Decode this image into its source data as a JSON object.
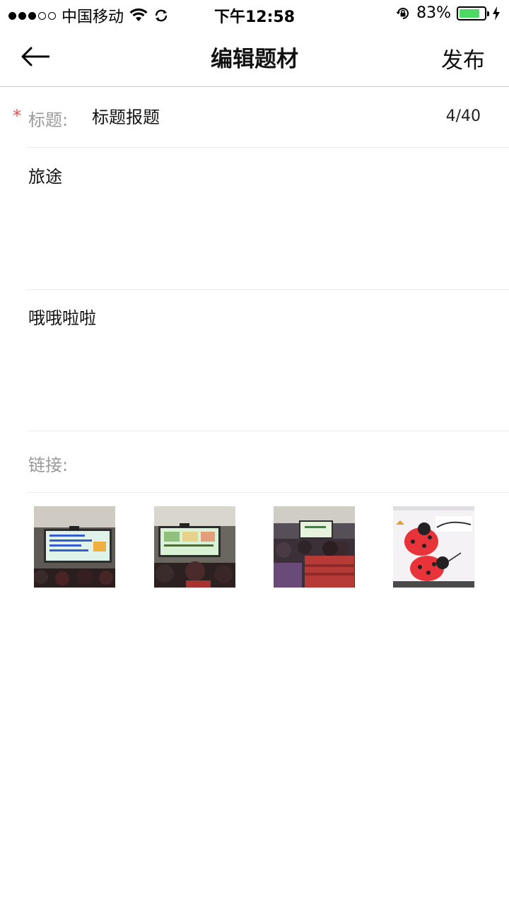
{
  "status_bar": {
    "carrier": "中国移动",
    "time": "下午12:58",
    "battery_percent_text": "83%",
    "battery_level": 0.83,
    "signal_bars_filled": 3,
    "signal_bars_total": 5,
    "battery_color": "#4cd964"
  },
  "nav": {
    "title": "编辑题材",
    "publish_label": "发布"
  },
  "form": {
    "required_mark": "*",
    "title_label": "标题:",
    "title_value": "标题报题",
    "title_counter": "4/40",
    "content_block_1": "旅途",
    "content_block_2": "哦哦啦啦",
    "link_label": "链接:",
    "link_value": "",
    "required_color": "#e55050"
  },
  "images": [
    {
      "name": "photo-1",
      "description_icon": "photo-icon"
    },
    {
      "name": "photo-2",
      "description_icon": "photo-icon"
    },
    {
      "name": "photo-3",
      "description_icon": "photo-icon"
    },
    {
      "name": "photo-4",
      "description_icon": "photo-icon"
    }
  ]
}
